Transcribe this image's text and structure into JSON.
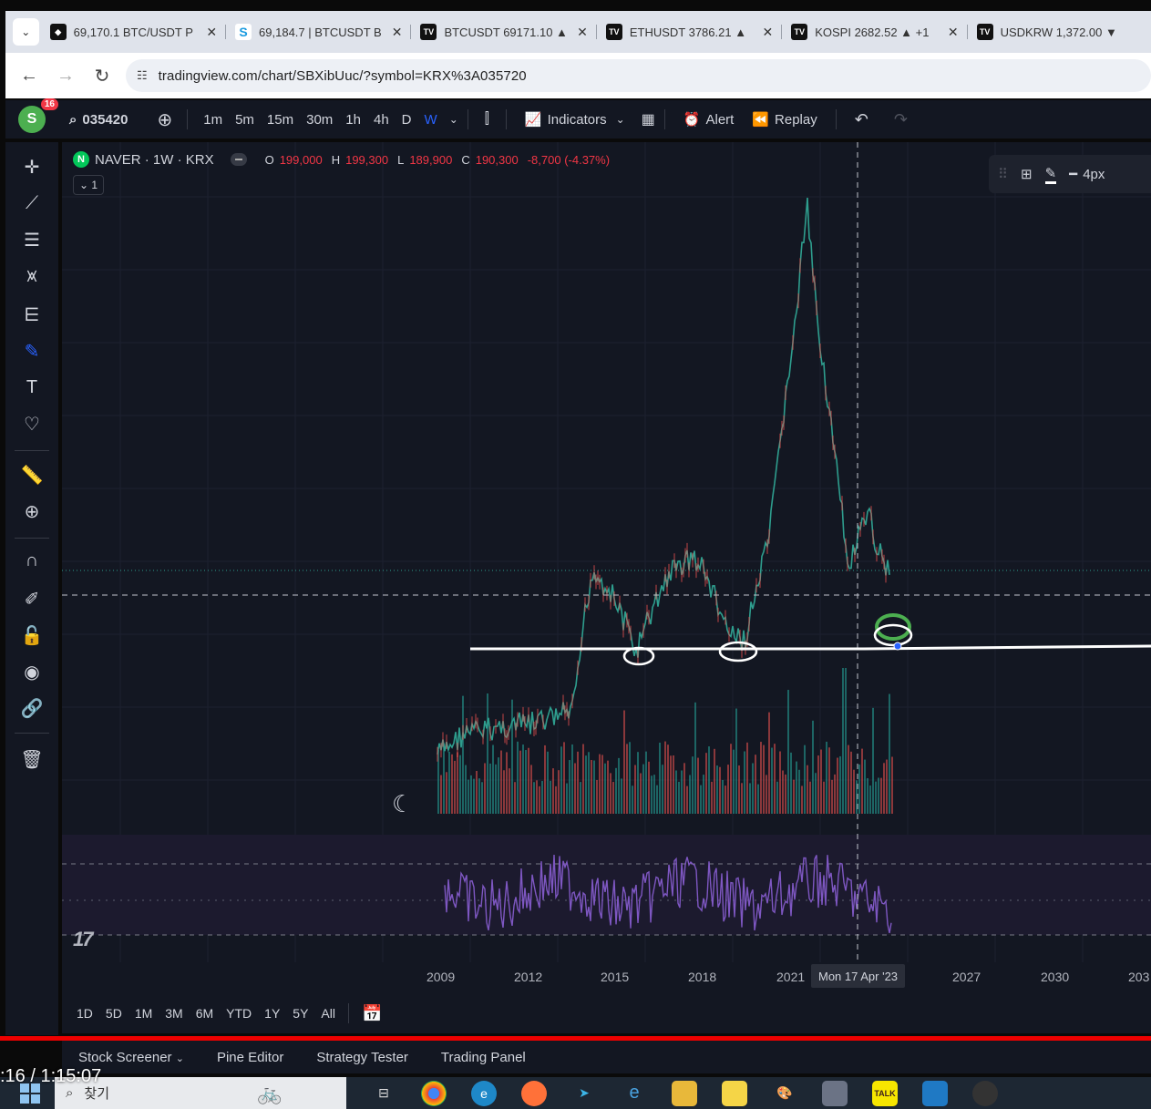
{
  "browser": {
    "tabs": [
      {
        "icon": "binance-logo",
        "label": "69,170.1 BTC/USDT P"
      },
      {
        "icon": "s-logo",
        "label": "69,184.7 | BTCUSDT B"
      },
      {
        "icon": "tradingview-logo",
        "label": "BTCUSDT 69171.10 ▲"
      },
      {
        "icon": "tradingview-logo",
        "label": "ETHUSDT 3786.21 ▲"
      },
      {
        "icon": "tradingview-logo",
        "label": "KOSPI 2682.52 ▲ +1"
      },
      {
        "icon": "tradingview-logo",
        "label": "USDKRW 1,372.00 ▼"
      }
    ],
    "url": "tradingview.com/chart/SBXibUuc/?symbol=KRX%3A035720"
  },
  "toolbar": {
    "avatar_letter": "S",
    "notifications": "16",
    "symbol": "035420",
    "timeframes": [
      "1m",
      "5m",
      "15m",
      "30m",
      "1h",
      "4h",
      "D",
      "W"
    ],
    "active_timeframe": "W",
    "indicators_label": "Indicators",
    "alert_label": "Alert",
    "replay_label": "Replay"
  },
  "legend": {
    "logo_letter": "N",
    "title": "NAVER · 1W · KRX",
    "open_key": "O",
    "open": "199,000",
    "high_key": "H",
    "high": "199,300",
    "low_key": "L",
    "low": "189,900",
    "close_key": "C",
    "close": "190,300",
    "change": "-8,700 (-4.37%)",
    "collapse_count": "1"
  },
  "right_tools": {
    "width_label": "4px"
  },
  "time_axis": {
    "labels": [
      "2009",
      "2012",
      "2015",
      "2018",
      "2021",
      "2027",
      "2030",
      "203"
    ],
    "crosshair_label": "Mon 17 Apr '23"
  },
  "ranges": [
    "1D",
    "5D",
    "1M",
    "3M",
    "6M",
    "YTD",
    "1Y",
    "5Y",
    "All"
  ],
  "bottom_tabs": [
    "Stock Screener",
    "Pine Editor",
    "Strategy Tester",
    "Trading Panel"
  ],
  "video_time": ":16 / 1:15:07",
  "taskbar": {
    "search_label": "찾기"
  },
  "colors": {
    "up": "#26a69a",
    "down": "#ef5350",
    "accent": "#2962ff",
    "bg": "#131722",
    "rsi": "#7e57c2"
  }
}
